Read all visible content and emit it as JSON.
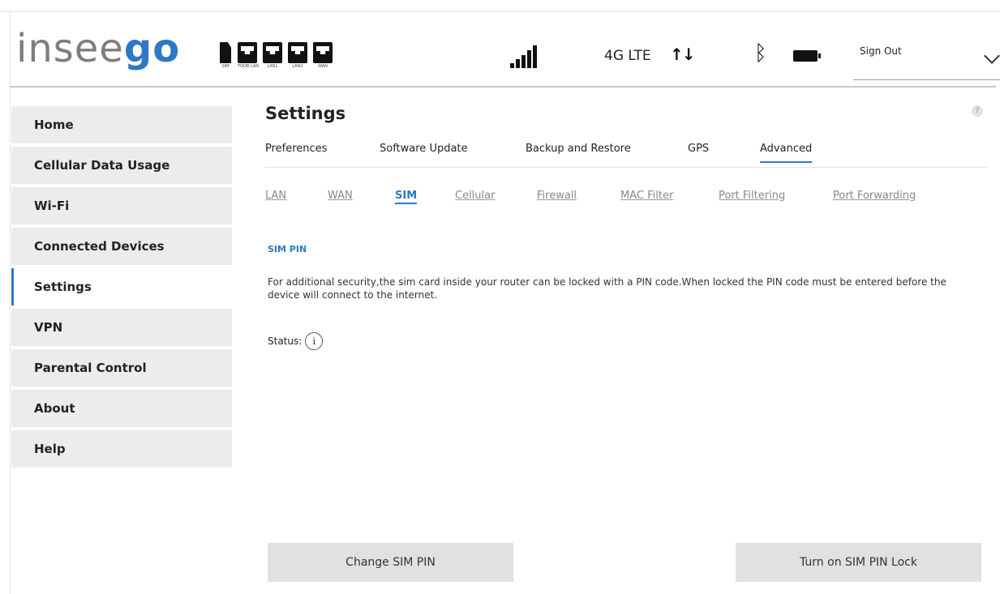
{
  "header": {
    "logo_part1": "insee",
    "logo_part2": "go",
    "ports": [
      {
        "type": "sim",
        "caption": "SIM",
        "icon": "sim-card-icon"
      },
      {
        "type": "port",
        "caption": "TOOB LAN",
        "icon": "ethernet-port-icon"
      },
      {
        "type": "port",
        "caption": "LAN1",
        "icon": "ethernet-port-icon"
      },
      {
        "type": "port",
        "caption": "LAN2",
        "icon": "ethernet-port-icon"
      },
      {
        "type": "port",
        "caption": "WAN",
        "icon": "ethernet-port-icon"
      }
    ],
    "network_label": "4G LTE",
    "data_arrows": "↑↓",
    "bluetooth_icon": "bluetooth-icon",
    "battery_icon": "battery-icon",
    "signout_label": "Sign Out"
  },
  "sidebar": {
    "items": [
      {
        "label": "Home",
        "active": false
      },
      {
        "label": "Cellular Data Usage",
        "active": false
      },
      {
        "label": "Wi-Fi",
        "active": false
      },
      {
        "label": "Connected Devices",
        "active": false
      },
      {
        "label": "Settings",
        "active": true
      },
      {
        "label": "VPN",
        "active": false
      },
      {
        "label": "Parental Control",
        "active": false
      },
      {
        "label": "About",
        "active": false
      },
      {
        "label": "Help",
        "active": false
      }
    ]
  },
  "main": {
    "title": "Settings",
    "help_icon": "help-icon",
    "tabs": [
      {
        "label": "Preferences",
        "active": false
      },
      {
        "label": "Software Update",
        "active": false
      },
      {
        "label": "Backup and Restore",
        "active": false
      },
      {
        "label": "GPS",
        "active": false
      },
      {
        "label": "Advanced",
        "active": true
      }
    ],
    "subtabs": [
      {
        "label": "LAN",
        "active": false
      },
      {
        "label": "WAN",
        "active": false
      },
      {
        "label": "SIM",
        "active": true
      },
      {
        "label": "Cellular",
        "active": false
      },
      {
        "label": "Firewall",
        "active": false
      },
      {
        "label": "MAC Filter",
        "active": false
      },
      {
        "label": "Port Filtering",
        "active": false
      },
      {
        "label": "Port Forwarding",
        "active": false
      }
    ],
    "section_label": "SIM PIN",
    "description": "For additional security,the sim card inside your router can be locked with a PIN code.When locked the PIN code must be entered before the device will connect to the internet.",
    "status_label": "Status:",
    "status_icon_glyph": "i",
    "buttons": {
      "change_pin": "Change SIM PIN",
      "pin_lock": "Turn on SIM PIN Lock"
    }
  },
  "colors": {
    "accent": "#2f78c4",
    "nav_bg": "#ececec",
    "button_bg": "#e1e1e1"
  }
}
